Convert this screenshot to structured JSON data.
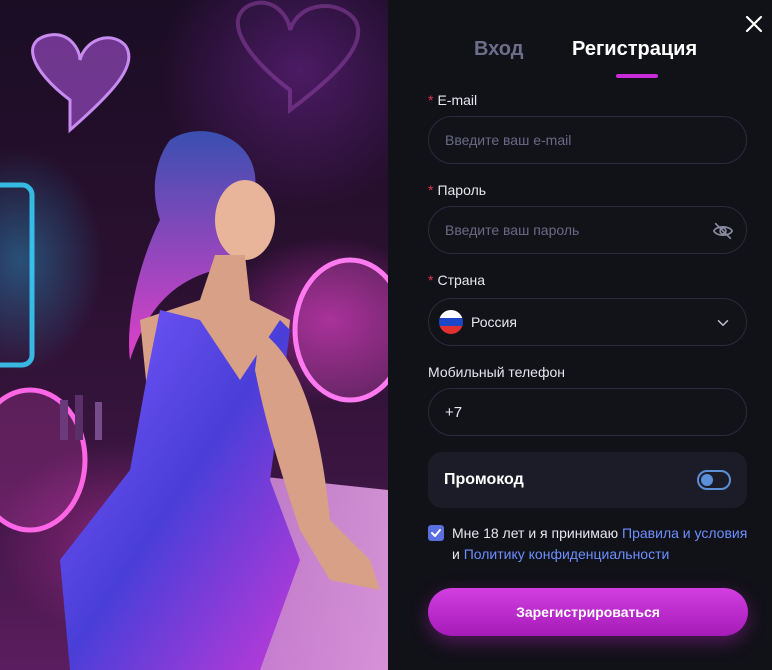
{
  "tabs": {
    "login": "Вход",
    "register": "Регистрация"
  },
  "email": {
    "label": "E-mail",
    "placeholder": "Введите ваш e-mail"
  },
  "password": {
    "label": "Пароль",
    "placeholder": "Введите ваш пароль"
  },
  "country": {
    "label": "Страна",
    "value": "Россия"
  },
  "phone": {
    "label": "Мобильный телефон",
    "value": "+7"
  },
  "promo": {
    "label": "Промокод",
    "enabled": false
  },
  "agreement": {
    "checked": true,
    "text_before": "Мне 18 лет и я принимаю ",
    "rules_link": "Правила и условия",
    "conjunction": " и ",
    "privacy_link": "Политику конфиденциальности"
  },
  "submit_label": "Зарегистрироваться",
  "required_mark": "*",
  "colors": {
    "accent": "#c82bd8",
    "link": "#6d8fff",
    "background": "#111118"
  },
  "icons": {
    "close": "close-icon",
    "password_toggle": "eye-off-icon",
    "dropdown": "chevron-down-icon",
    "flag": "russia-flag-icon",
    "checkbox": "checkmark-icon"
  }
}
